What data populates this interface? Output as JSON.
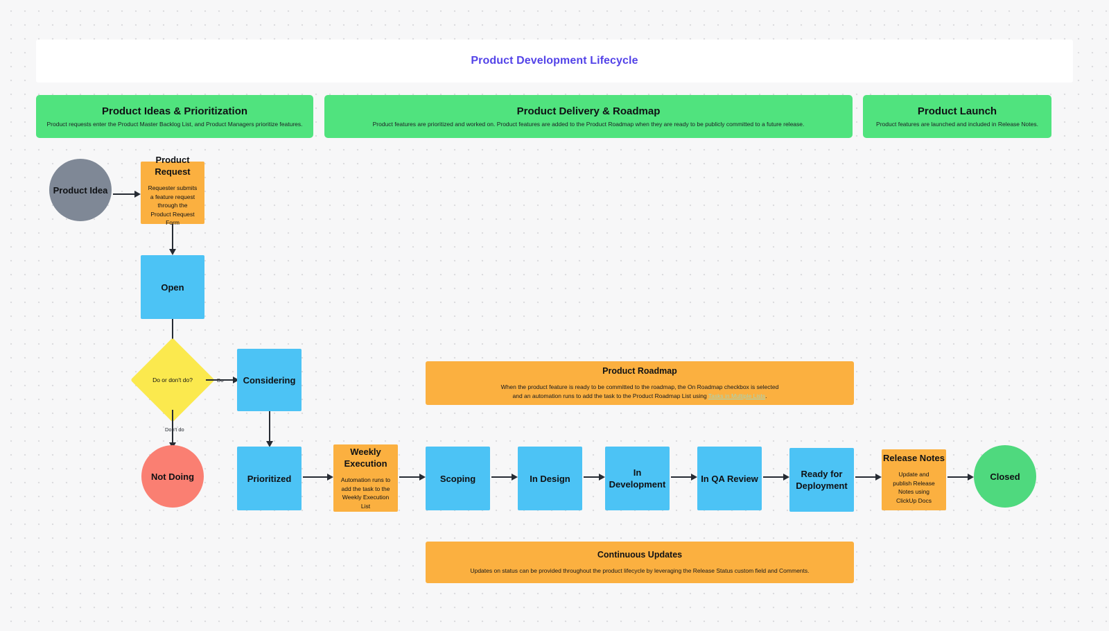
{
  "header": {
    "title": "Product Development Lifecycle",
    "title_color": "#5343e8"
  },
  "lanes": [
    {
      "title": "Product Ideas & Prioritization",
      "subtitle": "Product requests enter the Product Master Backlog List, and Product Managers prioritize features.",
      "color": "#50e37e"
    },
    {
      "title": "Product Delivery & Roadmap",
      "subtitle": "Product features are prioritized and worked on. Product features are added to the Product Roadmap when they are ready to be publicly committed to a future release.",
      "color": "#50e37e"
    },
    {
      "title": "Product Launch",
      "subtitle": "Product features are launched and included in Release Notes.",
      "color": "#50e37e"
    }
  ],
  "nodes": {
    "product_idea": {
      "title": "Product Idea",
      "shape": "circle",
      "color": "#7f8896"
    },
    "product_request": {
      "title": "Product Request",
      "subtitle": "Requester submits a feature request through the Product Request Form",
      "shape": "rect",
      "color": "#fbb040"
    },
    "open": {
      "title": "Open",
      "shape": "rect",
      "color": "#4cc3f5"
    },
    "decision": {
      "title": "Do or don't do?",
      "shape": "diamond",
      "color": "#fbe94e"
    },
    "considering": {
      "title": "Considering",
      "shape": "rect",
      "color": "#4cc3f5"
    },
    "not_doing": {
      "title": "Not Doing",
      "shape": "circle",
      "color": "#fa7f72"
    },
    "prioritized": {
      "title": "Prioritized",
      "shape": "rect",
      "color": "#4cc3f5"
    },
    "weekly_execution": {
      "title_line1": "Weekly",
      "title_line2": "Execution",
      "subtitle": "Automation runs to add the task to the Weekly Execution List",
      "shape": "rect",
      "color": "#fbb040"
    },
    "scoping": {
      "title": "Scoping",
      "shape": "rect",
      "color": "#4cc3f5"
    },
    "in_design": {
      "title": "In Design",
      "shape": "rect",
      "color": "#4cc3f5"
    },
    "in_development": {
      "title": "In Development",
      "shape": "rect",
      "color": "#4cc3f5"
    },
    "in_qa_review": {
      "title": "In QA Review",
      "shape": "rect",
      "color": "#4cc3f5"
    },
    "ready_for_deployment": {
      "title_line1": "Ready for",
      "title_line2": "Deployment",
      "shape": "rect",
      "color": "#4cc3f5"
    },
    "release_notes": {
      "title": "Release Notes",
      "subtitle": "Update and publish Release Notes using ClickUp Docs",
      "shape": "rect",
      "color": "#fbb040"
    },
    "closed": {
      "title": "Closed",
      "shape": "circle",
      "color": "#4fd97e"
    }
  },
  "edge_labels": {
    "do": "Do",
    "dont_do": "Don't do"
  },
  "banners": {
    "roadmap": {
      "title": "Product Roadmap",
      "line1": "When the product feature is ready to be committed to the roadmap, the On Roadmap checkbox is selected",
      "line2_pre": "and an automation runs to add the task to the Product Roadmap List using ",
      "line2_link": "Tasks in Multiple Lists",
      "line2_post": ".",
      "color": "#fbb040"
    },
    "continuous": {
      "title": "Continuous Updates",
      "line1": "Updates on status can be provided throughout the product lifecycle by leveraging the Release Status custom field and Comments.",
      "color": "#fbb040"
    }
  }
}
